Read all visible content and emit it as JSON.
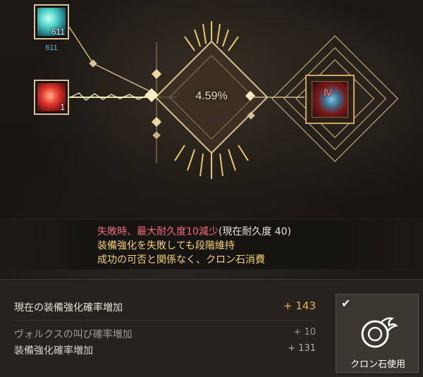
{
  "materials": {
    "top_slot": {
      "icon": "cron-stone-orb-icon",
      "quantity": "611",
      "below_count": "611"
    },
    "bottom_slot": {
      "icon": "fire-crystal-icon",
      "quantity": "1"
    }
  },
  "enhancement": {
    "success_rate": "4.59%",
    "result_item": {
      "icon": "accessory-icon",
      "grade": "Ⅳ"
    }
  },
  "notes": {
    "failure": "失敗時、最大耐久度10減少",
    "failure_current": "(現在耐久度 40)",
    "keep_stage": "装備強化を失敗しても段階維持",
    "cron_consume": "成功の可否と関係なく、クロン石消費"
  },
  "stats": {
    "current_label": "現在の装備強化確率増加",
    "current_value": "+ 143",
    "valks_label": "ヴォルクスの叫び確率増加",
    "valks_value": "+ 10",
    "enh_label": "装備強化確率増加",
    "enh_value": "+ 131"
  },
  "cron_button": {
    "label": "クロン石使用",
    "checked": true,
    "icon": "cron-stone-icon",
    "check_icon": "check-icon"
  },
  "colors": {
    "accent_gold": "#e9b54a",
    "warning_pink": "#f16a7c",
    "note_yellow": "#f2d36b",
    "count_blue": "#5fb4e0",
    "frame_gold": "#d8c498"
  }
}
